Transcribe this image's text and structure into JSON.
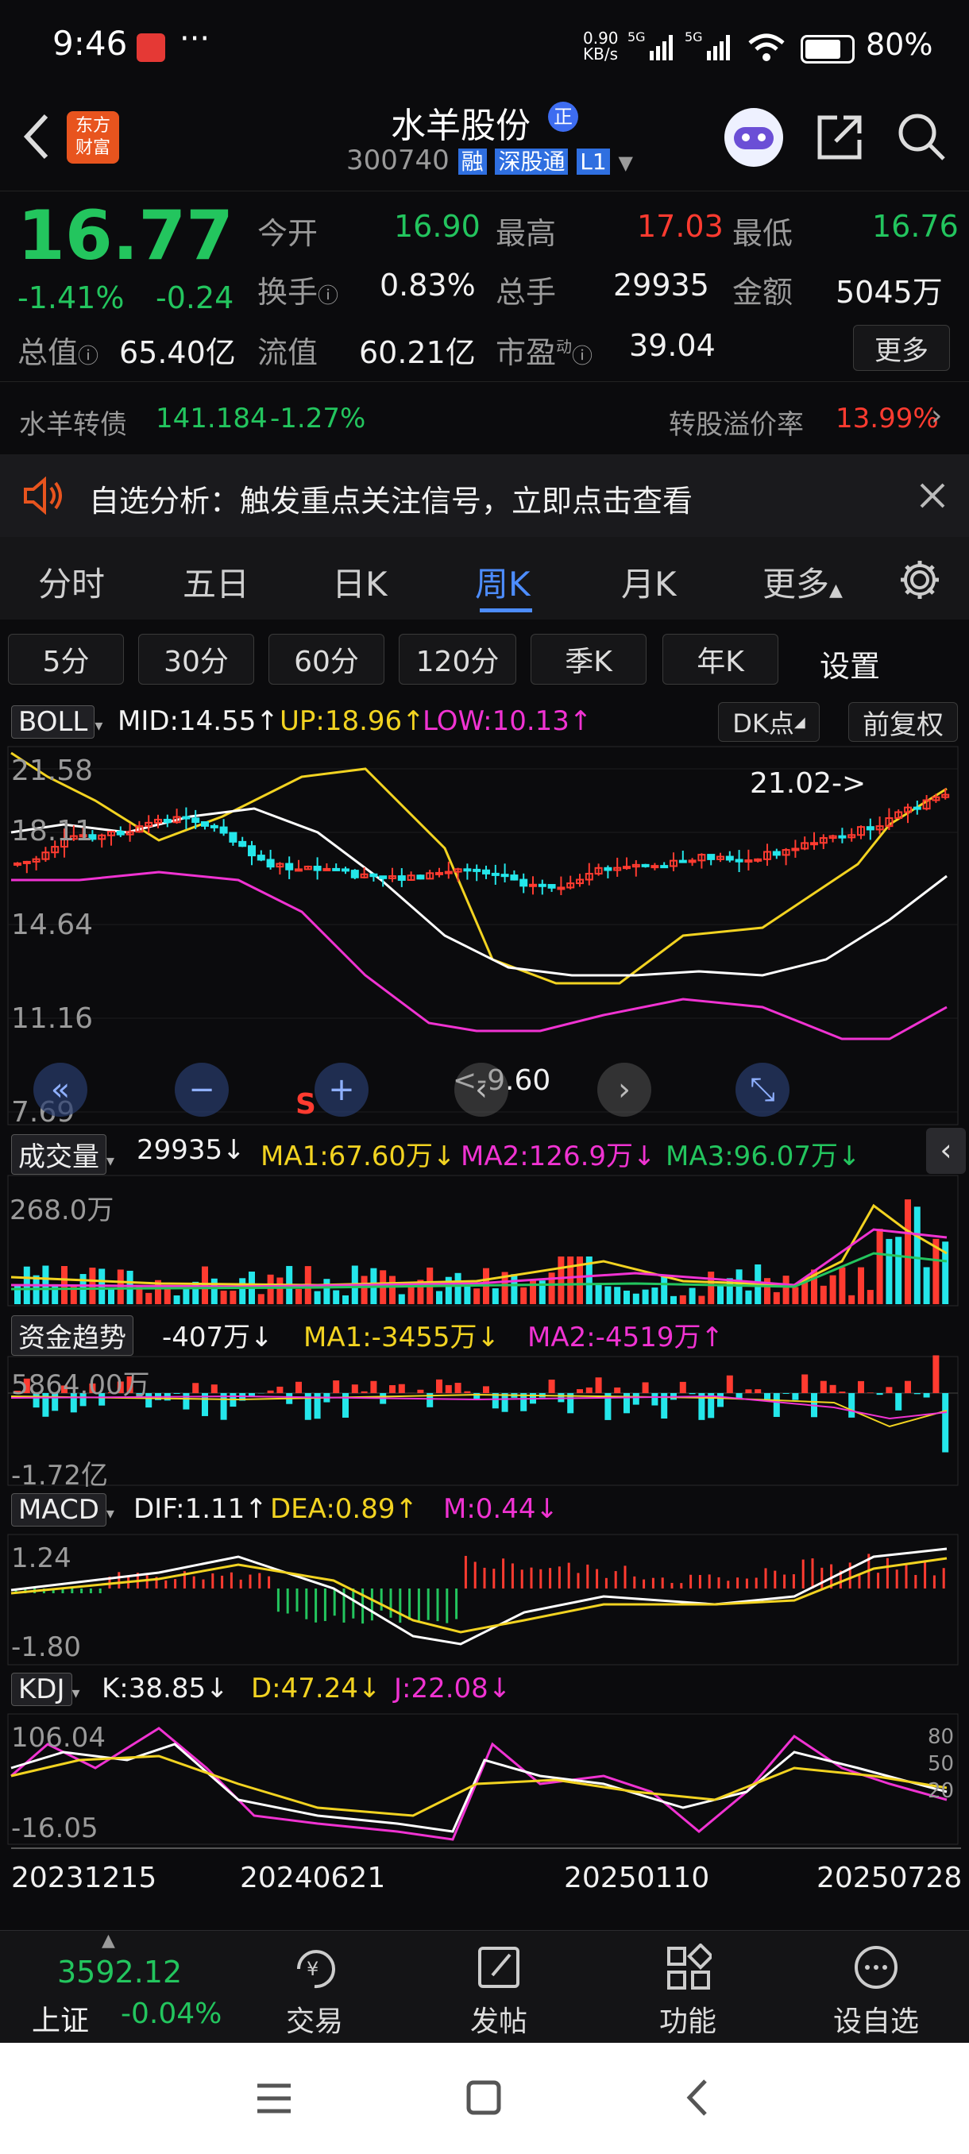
{
  "status": {
    "time": "9:46",
    "net_speed_top": "0.90",
    "net_speed_unit": "KB/s",
    "battery": "80%"
  },
  "header": {
    "logo_line1": "东方",
    "logo_line2": "财富",
    "title": "水羊股份",
    "title_badge": "正",
    "code": "300740",
    "tag1": "融",
    "tag2": "深股通",
    "tag3": "L1"
  },
  "quote": {
    "price": "16.77",
    "pct": "-1.41%",
    "chg": "-0.24",
    "open_label": "今开",
    "open": "16.90",
    "high_label": "最高",
    "high": "17.03",
    "low_label": "最低",
    "low": "16.76",
    "turnover_label": "换手",
    "turnover": "0.83%",
    "vol_label": "总手",
    "vol": "29935",
    "amount_label": "金额",
    "amount": "5045万",
    "mktcap_label": "总值",
    "mktcap": "65.40亿",
    "float_label": "流值",
    "float": "60.21亿",
    "pe_label": "市盈",
    "pe_sup": "动",
    "pe": "39.04",
    "more": "更多"
  },
  "bond": {
    "name": "水羊转债",
    "price": "141.184",
    "pct": "-1.27%",
    "premium_label": "转股溢价率",
    "premium": "13.99%"
  },
  "notice": {
    "text": "自选分析：触发重点关注信号，立即点击查看"
  },
  "tabs": [
    "分时",
    "五日",
    "日K",
    "周K",
    "月K",
    "更多"
  ],
  "active_tab": "周K",
  "periods": [
    "5分",
    "30分",
    "60分",
    "120分",
    "季K",
    "年K"
  ],
  "settings_label": "设置",
  "boll": {
    "name": "BOLL",
    "mid": "MID:14.55",
    "up": "UP:18.96",
    "low": "LOW:10.13",
    "dk": "DK点",
    "adjust": "前复权",
    "y_labels": [
      "21.58",
      "18.11",
      "14.64",
      "11.16",
      "7.69"
    ],
    "high_mark": "21.02->",
    "low_mark": "<-9.60",
    "s_mark": "S"
  },
  "volume": {
    "name": "成交量",
    "value": "29935",
    "ma1": "MA1:67.60万",
    "ma2": "MA2:126.9万",
    "ma3": "MA3:96.07万",
    "y_top": "268.0万"
  },
  "fund": {
    "name": "资金趋势",
    "value": "-407万",
    "ma1": "MA1:-3455万",
    "ma2": "MA2:-4519万",
    "y_top": "5864.00万",
    "y_bottom": "-1.72亿"
  },
  "macd": {
    "name": "MACD",
    "dif": "DIF:1.11",
    "dea": "DEA:0.89",
    "m": "M:0.44",
    "y_top": "1.24",
    "y_bottom": "-1.80"
  },
  "kdj": {
    "name": "KDJ",
    "k": "K:38.85",
    "d": "D:47.24",
    "j": "J:22.08",
    "y_top": "106.04",
    "y_bottom": "-16.05",
    "right_labels": [
      "80",
      "50",
      "20"
    ]
  },
  "dates": [
    "20231215",
    "20240621",
    "20250110",
    "20250728"
  ],
  "index": {
    "value": "3592.12",
    "name": "上证",
    "pct": "-0.04%"
  },
  "bottom_nav": [
    "交易",
    "发帖",
    "功能",
    "设自选"
  ],
  "colors": {
    "up": "#ff3b30",
    "down": "#24e6ea",
    "accent": "#2f7bff",
    "boll_up": "#f2d321",
    "boll_low": "#f033d2",
    "boll_mid": "#ffffff"
  }
}
